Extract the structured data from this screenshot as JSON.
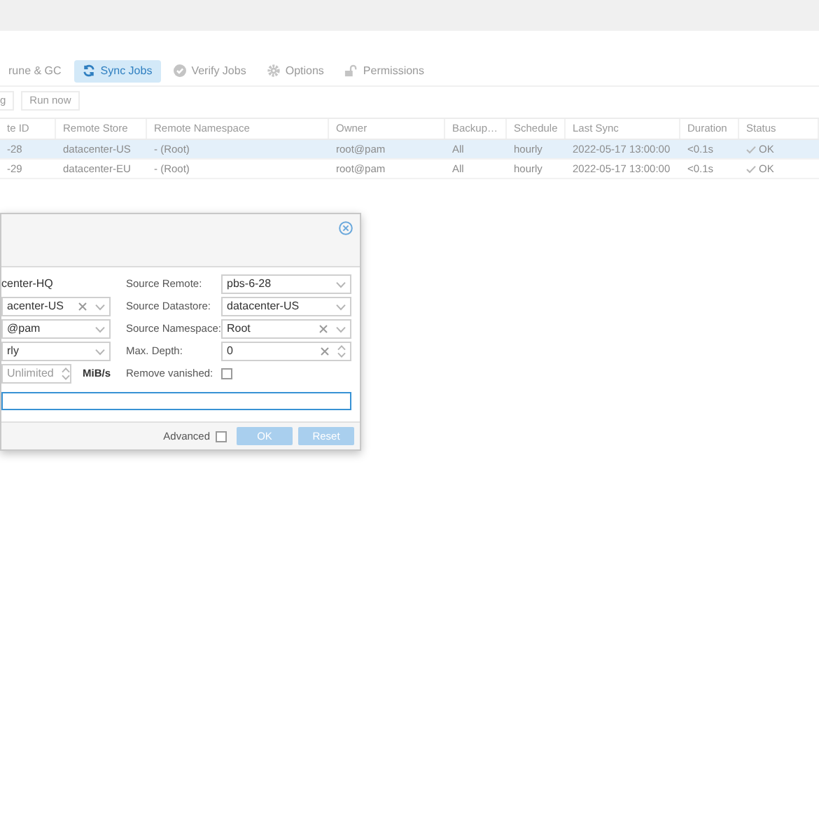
{
  "tabs": [
    {
      "label": "rune & GC",
      "selected": false
    },
    {
      "label": "Sync Jobs",
      "selected": true
    },
    {
      "label": "Verify Jobs",
      "selected": false
    },
    {
      "label": "Options",
      "selected": false
    },
    {
      "label": "Permissions",
      "selected": false
    }
  ],
  "toolbar": [
    "g",
    "Run now"
  ],
  "table": {
    "columns": [
      "te ID",
      "Remote Store",
      "Remote Namespace",
      "Owner",
      "Backup…",
      "Schedule",
      "Last Sync",
      "Duration",
      "Status"
    ],
    "rows": [
      {
        "selected": true,
        "cells": [
          "-28",
          "datacenter-US",
          "- (Root)",
          "root@pam",
          "All",
          "hourly",
          "2022-05-17 13:00:00",
          "<0.1s",
          "OK"
        ]
      },
      {
        "selected": false,
        "cells": [
          "-29",
          "datacenter-EU",
          "- (Root)",
          "root@pam",
          "All",
          "hourly",
          "2022-05-17 13:00:00",
          "<0.1s",
          "OK"
        ]
      }
    ]
  },
  "dialog": {
    "left": [
      {
        "kind": "display",
        "value": "center-HQ"
      },
      {
        "kind": "combo",
        "value": "acenter-US",
        "clearable": true
      },
      {
        "kind": "combo",
        "value": "@pam",
        "clearable": false
      },
      {
        "kind": "combo",
        "value": "rly",
        "clearable": false
      },
      {
        "kind": "spinner",
        "placeholder": "Unlimited",
        "unit": "MiB/s",
        "clearable": false
      }
    ],
    "right": [
      {
        "kind": "combo",
        "label": "Source Remote:",
        "value": "pbs-6-28",
        "clearable": false
      },
      {
        "kind": "combo",
        "label": "Source Datastore:",
        "value": "datacenter-US",
        "clearable": false
      },
      {
        "kind": "combo",
        "label": "Source Namespace:",
        "value": "Root",
        "clearable": true
      },
      {
        "kind": "spinner",
        "label": "Max. Depth:",
        "value": "0",
        "clearable": true
      },
      {
        "kind": "checkbox",
        "label": "Remove vanished:",
        "checked": false
      }
    ],
    "comment": {
      "focused": true
    },
    "advanced": {
      "label": "Advanced",
      "checked": false
    },
    "buttons": [
      {
        "label": "OK",
        "disabled": true
      },
      {
        "label": "Reset",
        "disabled": true
      }
    ]
  }
}
